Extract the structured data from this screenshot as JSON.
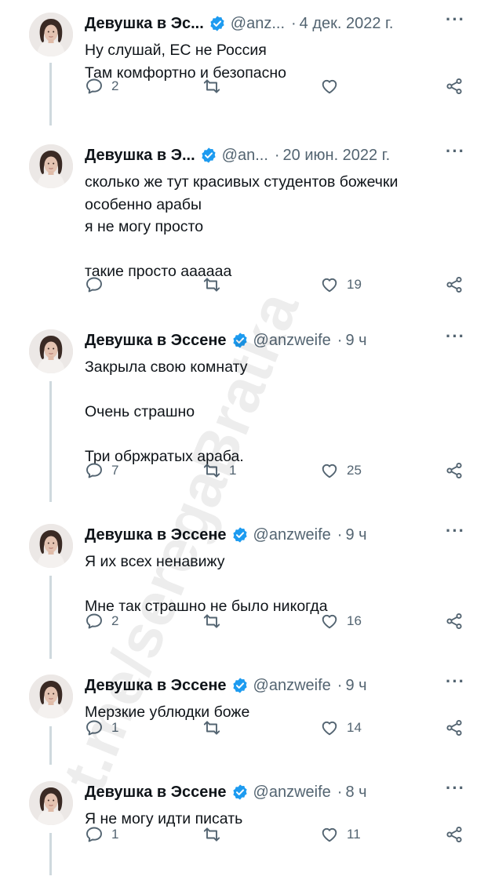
{
  "author": {
    "name_full": "Девушка в Эссене",
    "handle_full": "@anzweife"
  },
  "watermark": "t.me/seregaBratka",
  "colors": {
    "text": "#0f1419",
    "secondary": "#536471",
    "verified": "#1d9bf0",
    "line": "#cfd9de"
  },
  "tweets": [
    {
      "name": "Девушка в Эс...",
      "handle": "@anz...",
      "sep": "·",
      "time": "4 дек. 2022 г.",
      "more": "···",
      "lines": [
        "Ну слушай, ЕС не Россия",
        "Там комфортно и безопасно"
      ],
      "reply_count": "2",
      "retweet_count": "",
      "like_count": ""
    },
    {
      "name": "Девушка в Э...",
      "handle": "@an...",
      "sep": "·",
      "time": "20 июн. 2022 г.",
      "more": "···",
      "lines": [
        "сколько же тут красивых студентов божечки",
        "особенно арабы",
        "я не могу просто",
        "",
        "такие просто аааааа"
      ],
      "reply_count": "",
      "retweet_count": "",
      "like_count": "19"
    },
    {
      "name": "Девушка в Эссене",
      "handle": "@anzweife",
      "sep": "·",
      "time": "9 ч",
      "more": "···",
      "lines": [
        "Закрыла свою комнату",
        "",
        "Очень страшно",
        "",
        "Три обржратых араба."
      ],
      "reply_count": "7",
      "retweet_count": "1",
      "like_count": "25"
    },
    {
      "name": "Девушка в Эссене",
      "handle": "@anzweife",
      "sep": "·",
      "time": "9 ч",
      "more": "···",
      "lines": [
        "Я их всех ненавижу",
        "",
        "Мне так страшно не было никогда"
      ],
      "reply_count": "2",
      "retweet_count": "",
      "like_count": "16"
    },
    {
      "name": "Девушка в Эссене",
      "handle": "@anzweife",
      "sep": "·",
      "time": "9 ч",
      "more": "···",
      "lines": [
        "Мерзкие ублюдки боже"
      ],
      "reply_count": "1",
      "retweet_count": "",
      "like_count": "14"
    },
    {
      "name": "Девушка в Эссене",
      "handle": "@anzweife",
      "sep": "·",
      "time": "8 ч",
      "more": "···",
      "lines": [
        "Я не могу идти писать"
      ],
      "reply_count": "1",
      "retweet_count": "",
      "like_count": "11"
    }
  ]
}
